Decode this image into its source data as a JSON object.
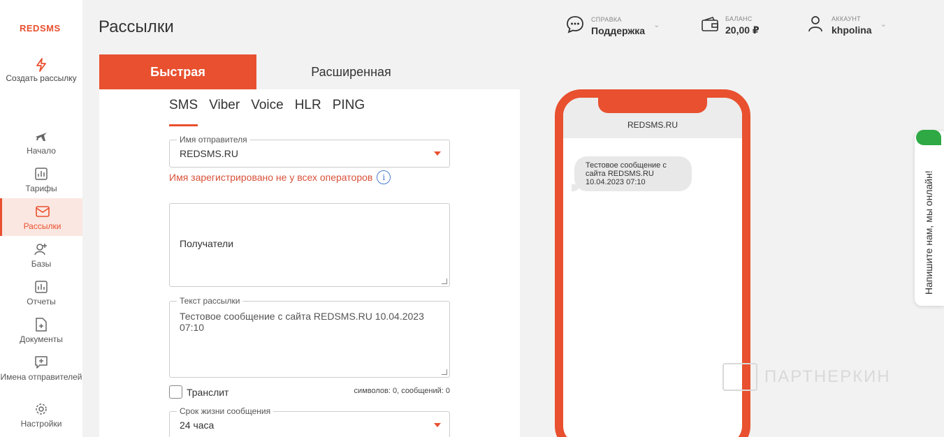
{
  "brand": {
    "logo": "REDSMS",
    "accent": "#e8502f"
  },
  "page": {
    "title": "Рассылки"
  },
  "sidebar": {
    "create": "Создать рассылку",
    "items": [
      {
        "label": "Начало",
        "icon": "plane-icon"
      },
      {
        "label": "Тарифы",
        "icon": "bar-chart-icon"
      },
      {
        "label": "Рассылки",
        "icon": "envelope-icon"
      },
      {
        "label": "Базы",
        "icon": "add-user-icon"
      },
      {
        "label": "Отчеты",
        "icon": "report-icon"
      },
      {
        "label": "Документы",
        "icon": "document-add-icon"
      },
      {
        "label": "Имена отправителей",
        "icon": "message-add-icon"
      },
      {
        "label": "Настройки",
        "icon": "gear-icon"
      }
    ]
  },
  "header": {
    "support": {
      "caption": "СПРАВКА",
      "label": "Поддержка"
    },
    "balance": {
      "caption": "БАЛАНС",
      "value": "20,00 ₽"
    },
    "account": {
      "caption": "АККАУНТ",
      "name": "khpolina"
    }
  },
  "tabs": {
    "fast": "Быстрая",
    "extended": "Расширенная"
  },
  "channels": [
    "SMS",
    "Viber",
    "Voice",
    "HLR",
    "PING"
  ],
  "form": {
    "sender": {
      "legend": "Имя отправителя",
      "value": "REDSMS.RU"
    },
    "warning": "Имя зарегистрировано не у всех операторов",
    "recipients": {
      "placeholder": "Получатели"
    },
    "text": {
      "legend": "Текст рассылки",
      "value": "Тестовое сообщение с сайта REDSMS.RU 10.04.2023 07:10"
    },
    "translit": "Транслит",
    "counter": "символов: 0, сообщений: 0",
    "ttl": {
      "legend": "Срок жизни сообщения",
      "value": "24 часа"
    }
  },
  "preview": {
    "sender": "REDSMS.RU",
    "message": "Тестовое сообщение с сайта REDSMS.RU 10.04.2023 07:10"
  },
  "chat_widget": {
    "label": "Напишите нам, мы онлайн!"
  },
  "watermark": "ПАРТНЕРКИН"
}
